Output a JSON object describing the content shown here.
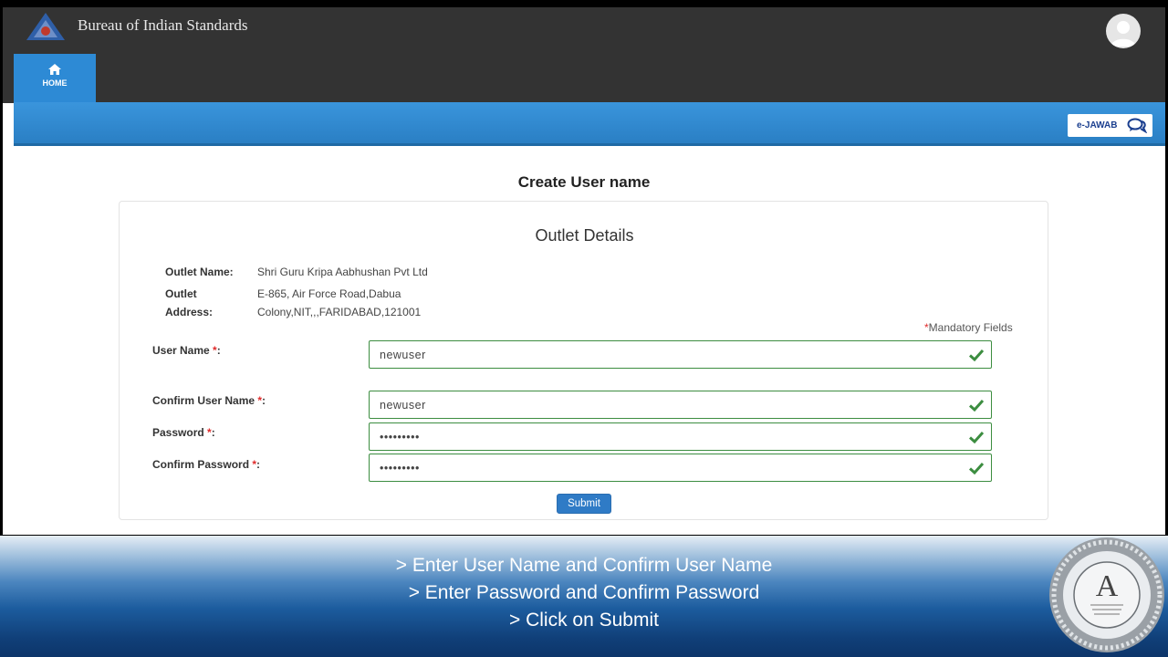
{
  "header": {
    "brand": "Bureau of Indian Standards",
    "nav": {
      "home_label": "HOME"
    },
    "ejawab_label": "e-JAWAB"
  },
  "page": {
    "title": "Create User name"
  },
  "outlet": {
    "section_title": "Outlet Details",
    "name_label": "Outlet Name:",
    "name_value": "Shri Guru Kripa Aabhushan Pvt Ltd",
    "address_label_1": "Outlet",
    "address_label_2": "Address:",
    "address_line_1": "E-865, Air Force Road,Dabua",
    "address_line_2": "Colony,NIT,,,FARIDABAD,121001"
  },
  "form": {
    "mandatory_star": "*",
    "mandatory_text": "Mandatory Fields",
    "fields": [
      {
        "label": "User Name",
        "value": "newuser"
      },
      {
        "label": "Confirm User Name",
        "value": "newuser"
      },
      {
        "label": "Password",
        "value": "•••••••••"
      },
      {
        "label": "Confirm Password",
        "value": "•••••••••"
      }
    ],
    "submit_label": "Submit"
  },
  "instructions": [
    "> Enter User Name and Confirm User Name",
    "> Enter Password and Confirm Password",
    "> Click on Submit"
  ],
  "seal": {
    "letter": "A"
  },
  "colors": {
    "topbar": "#333333",
    "accent_blue": "#2d8ad5",
    "valid_green": "#3c8d40",
    "required_red": "#e02b2b",
    "submit_blue": "#2f7bc6"
  }
}
